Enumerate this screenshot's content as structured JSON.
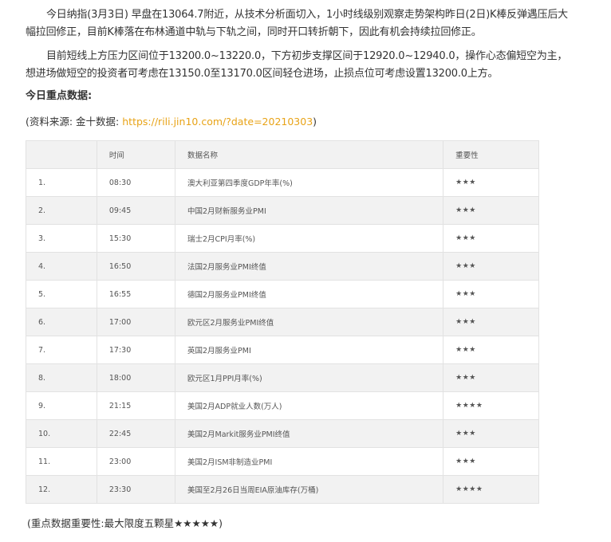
{
  "paragraphs": [
    "今日纳指(3月3日) 早盘在13064.7附近，从技术分析面切入，1小时线级别观察走势架构昨日(2日)K棒反弹遇压后大幅拉回修正，目前K棒落在布林通道中轨与下轨之间，同时开口转折朝下，因此有机会持续拉回修正。",
    "目前短线上方压力区间位于13200.0~13220.0，下方初步支撑区间于12920.0~12940.0，操作心态偏短空为主，想进场做短空的投资者可考虑在13150.0至13170.0区间轻仓进场，止损点位可考虑设置13200.0上方。"
  ],
  "heading": "今日重点数据:",
  "source": {
    "prefix": "(资料来源: 金十数据: ",
    "link": "https://rili.jin10.com/?date=20210303",
    "suffix": ")"
  },
  "table": {
    "headers": [
      "",
      "时间",
      "数据名称",
      "重要性"
    ],
    "rows": [
      {
        "idx": "1.",
        "time": "08:30",
        "name": "澳大利亚第四季度GDP年率(%)",
        "importance": "★★★"
      },
      {
        "idx": "2.",
        "time": "09:45",
        "name": "中国2月财新服务业PMI",
        "importance": "★★★"
      },
      {
        "idx": "3.",
        "time": "15:30",
        "name": "瑞士2月CPI月率(%)",
        "importance": "★★★"
      },
      {
        "idx": "4.",
        "time": "16:50",
        "name": "法国2月服务业PMI终值",
        "importance": "★★★"
      },
      {
        "idx": "5.",
        "time": "16:55",
        "name": "德国2月服务业PMI终值",
        "importance": "★★★"
      },
      {
        "idx": "6.",
        "time": "17:00",
        "name": "欧元区2月服务业PMI终值",
        "importance": "★★★"
      },
      {
        "idx": "7.",
        "time": "17:30",
        "name": "英国2月服务业PMI",
        "importance": "★★★"
      },
      {
        "idx": "8.",
        "time": "18:00",
        "name": "欧元区1月PPI月率(%)",
        "importance": "★★★"
      },
      {
        "idx": "9.",
        "time": "21:15",
        "name": "美国2月ADP就业人数(万人)",
        "importance": "★★★★"
      },
      {
        "idx": "10.",
        "time": "22:45",
        "name": "美国2月Markit服务业PMI终值",
        "importance": "★★★"
      },
      {
        "idx": "11.",
        "time": "23:00",
        "name": "美国2月ISM非制造业PMI",
        "importance": "★★★"
      },
      {
        "idx": "12.",
        "time": "23:30",
        "name": "美国至2月26日当周EIA原油库存(万桶)",
        "importance": "★★★★"
      }
    ]
  },
  "footnote": "(重点数据重要性:最大限度五颗星★★★★★)",
  "colors": {
    "link": "#e8a317",
    "row_stripe": "#f2f2f2",
    "border": "#e2e2e2"
  }
}
